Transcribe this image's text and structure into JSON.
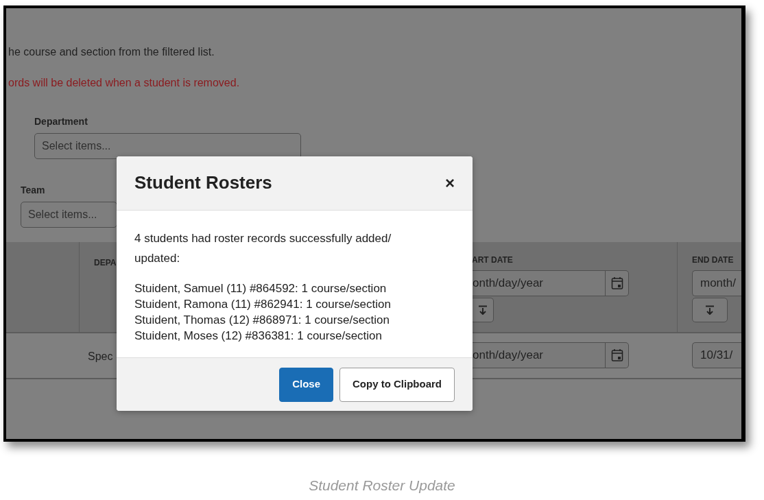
{
  "background": {
    "intro_lines": [
      {
        "kind": "normal",
        "text": "he course and section from the filtered list."
      },
      {
        "kind": "warning",
        "text": "ords will be deleted when a student is removed."
      }
    ],
    "filters": [
      {
        "label": "Department",
        "placeholder": "Select items..."
      },
      {
        "label": "Team",
        "placeholder": "Select items..."
      }
    ],
    "table": {
      "columns": [
        "DEPA",
        "ART DATE",
        "END DATE"
      ],
      "header_filters": [
        {
          "placeholder": "onth/day/year"
        },
        {
          "placeholder": "month/"
        }
      ],
      "rows": [
        {
          "department": "Spec",
          "start_date": {
            "placeholder": "onth/day/year"
          },
          "end_date": {
            "value": "10/31/"
          }
        }
      ]
    }
  },
  "modal": {
    "title": "Student Rosters",
    "close_symbol": "×",
    "message": "4 students had roster records successfully added/ updated:",
    "lines": [
      "Stuident, Samuel (11) #864592: 1 course/section",
      "Stuident, Ramona (11) #862941: 1 course/section",
      "Stuident, Thomas (12) #868971: 1 course/section",
      "Stuident, Moses (12) #836381: 1 course/section"
    ],
    "buttons": [
      {
        "label": "Close",
        "kind": "primary"
      },
      {
        "label": "Copy to Clipboard",
        "kind": "secondary"
      }
    ]
  },
  "caption": "Student Roster Update"
}
